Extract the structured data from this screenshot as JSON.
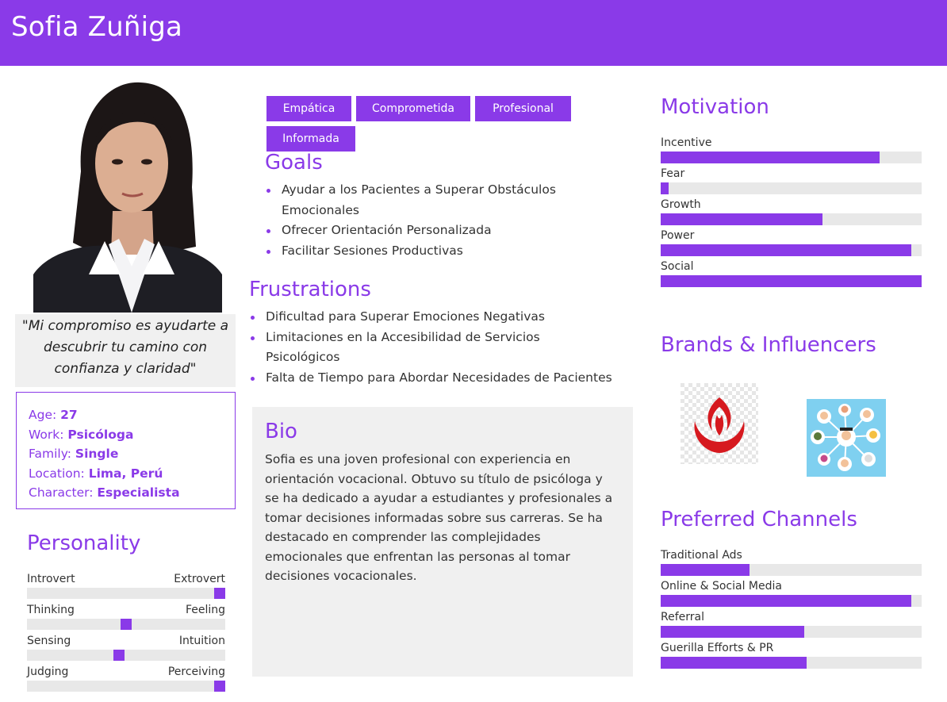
{
  "persona": {
    "name": "Sofia Zuñiga"
  },
  "quote": "\"Mi compromiso es ayudarte a descubrir tu camino con confianza y claridad\"",
  "info": [
    {
      "label": "Age:",
      "value": "27"
    },
    {
      "label": "Work:",
      "value": "Psicóloga"
    },
    {
      "label": "Family:",
      "value": "Single"
    },
    {
      "label": "Location:",
      "value": "Lima, Perú"
    },
    {
      "label": "Character:",
      "value": "Especialista"
    }
  ],
  "personality": {
    "title": "Personality",
    "traits": [
      {
        "left": "Introvert",
        "right": "Extrovert",
        "value": 1.0
      },
      {
        "left": "Thinking",
        "right": "Feeling",
        "value": 0.5
      },
      {
        "left": "Sensing",
        "right": "Intuition",
        "value": 0.46
      },
      {
        "left": "Judging",
        "right": "Perceiving",
        "value": 1.0
      }
    ]
  },
  "tags": [
    "Empática",
    "Comprometida",
    "Profesional",
    "Informada"
  ],
  "goals": {
    "title": "Goals",
    "items": [
      "Ayudar a los Pacientes a Superar Obstáculos Emocionales",
      "Ofrecer Orientación Personalizada",
      "Facilitar Sesiones Productivas"
    ]
  },
  "frustrations": {
    "title": "Frustrations",
    "items": [
      "Dificultad para Superar Emociones Negativas",
      "Limitaciones en la Accesibilidad de Servicios Psicológicos",
      "Falta de Tiempo para Abordar Necesidades de Pacientes"
    ]
  },
  "bio": {
    "title": "Bio",
    "text": "Sofia es una joven profesional con experiencia en orientación vocacional. Obtuvo su título de psicóloga y se ha dedicado a ayudar a estudiantes y profesionales a tomar decisiones informadas sobre sus carreras. Se ha destacado en comprender las complejidades emocionales que enfrentan las personas al tomar decisiones vocacionales."
  },
  "motivation": {
    "title": "Motivation",
    "items": [
      {
        "label": "Incentive",
        "value": 0.84
      },
      {
        "label": "Fear",
        "value": 0.03
      },
      {
        "label": "Growth",
        "value": 0.62
      },
      {
        "label": "Power",
        "value": 0.96
      },
      {
        "label": "Social",
        "value": 1.0
      }
    ]
  },
  "brands": {
    "title": "Brands & Influencers",
    "items": [
      {
        "icon": "upc-logo-icon"
      },
      {
        "icon": "people-network-icon"
      }
    ]
  },
  "channels": {
    "title": "Preferred Channels",
    "items": [
      {
        "label": "Traditional Ads",
        "value": 0.34
      },
      {
        "label": "Online & Social Media",
        "value": 0.96
      },
      {
        "label": "Referral",
        "value": 0.55
      },
      {
        "label": "Guerilla Efforts & PR",
        "value": 0.56
      }
    ]
  },
  "colors": {
    "accent": "#8a3ae8",
    "track": "#e8e8e8",
    "panel": "#f0f0f0"
  }
}
